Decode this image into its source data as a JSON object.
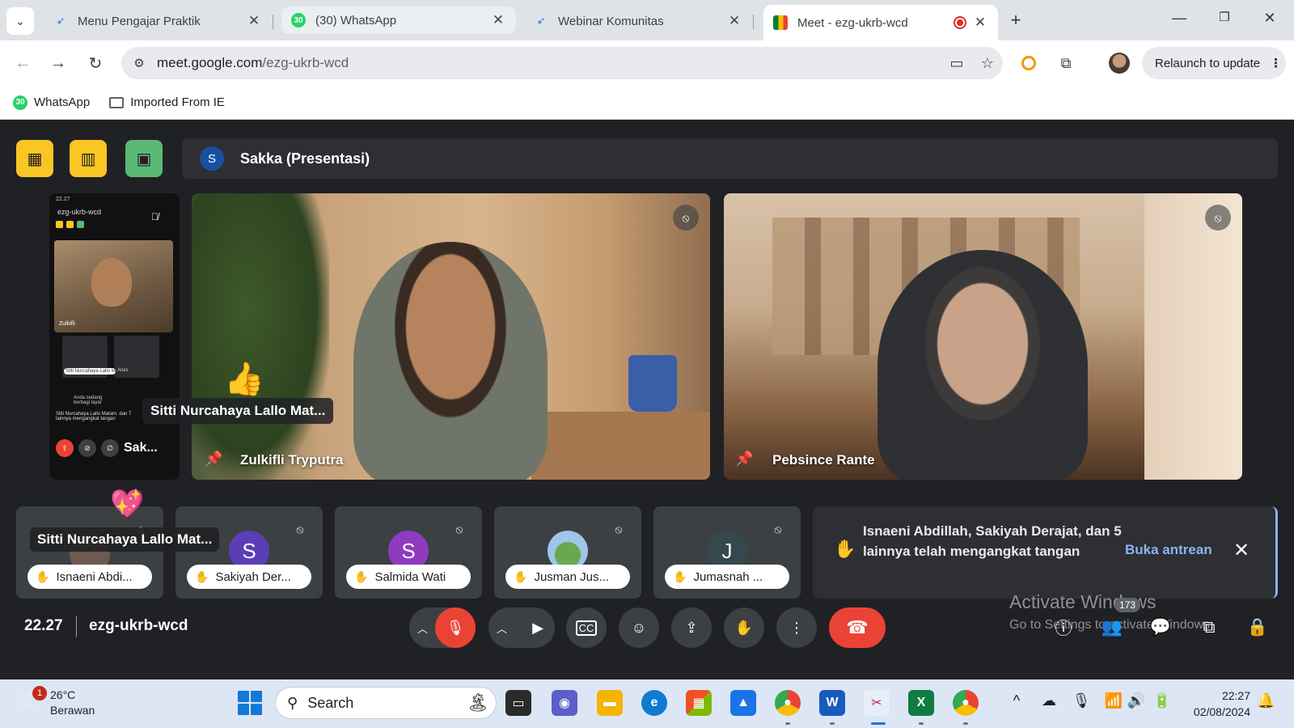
{
  "browser": {
    "tabs": [
      {
        "label": "Menu Pengajar Praktik",
        "icon": "bird-icon"
      },
      {
        "label": "(30) WhatsApp",
        "icon": "whatsapp-icon"
      },
      {
        "label": "Webinar Komunitas",
        "icon": "bird-icon"
      },
      {
        "label": "Meet - ezg-ukrb-wcd",
        "icon": "meet-icon",
        "active": true
      }
    ],
    "new_tab_glyph": "+",
    "url_domain": "meet.google.com",
    "url_path": "/ezg-ukrb-wcd",
    "relaunch_label": "Relaunch to update",
    "bookmarks": [
      {
        "label": "WhatsApp",
        "icon": "whatsapp-icon",
        "badge": "30"
      },
      {
        "label": "Imported From IE",
        "icon": "folder-icon"
      }
    ]
  },
  "meet": {
    "presenter_avatar": "S",
    "presenter_title": "Sakka (Presentasi)",
    "phone": {
      "status": "22.27",
      "code": "ezg-ukrb-wcd",
      "video_name": "Zulkifli",
      "cell_label_1": "Sitti Nurcahaya Lallo Mat...",
      "cell_label_2": "Aries",
      "note_1": "Anda sedang berbagi layar",
      "note_2": "Sitti Nurcahaya Lallo Matam. dan 7 lainnya mengangkat tangan",
      "bottom_label": "Sak..."
    },
    "tiles": [
      {
        "name": "Zulkifli Tryputra"
      },
      {
        "name": "Pebsince Rante"
      }
    ],
    "tooltip_top": "Sitti Nurcahaya Lallo Mat...",
    "tooltip_bottom": "Sitti Nurcahaya Lallo Mat...",
    "small_tiles": [
      {
        "avatar": "",
        "chip": "Isnaeni Abdi...",
        "color": "#3c4043"
      },
      {
        "avatar": "S",
        "chip": "Sakiyah Der...",
        "color": "#5b3eb5"
      },
      {
        "avatar": "S",
        "chip": "Salmida Wati",
        "color": "#8e3bc2"
      },
      {
        "avatar": "",
        "chip": "Jusman Jus...",
        "color": "#6aa84f"
      },
      {
        "avatar": "J",
        "chip": "Jumasnah ...",
        "color": "#37474f"
      }
    ],
    "notification": {
      "text": "Isnaeni Abdillah, Sakiyah Derajat, dan 5 lainnya telah mengangkat tangan",
      "action": "Buka antrean"
    },
    "time": "22.27",
    "code": "ezg-ukrb-wcd",
    "participants_count": "173",
    "activate_title": "Activate Windows",
    "activate_sub": "Go to Settings to activate Windows."
  },
  "taskbar": {
    "weather_temp": "26°C",
    "weather_desc": "Berawan",
    "weather_badge": "1",
    "search_placeholder": "Search",
    "time": "22:27",
    "date": "02/08/2024"
  },
  "colors": {
    "meet_bg": "#202124",
    "tool_yellow": "#f9c623",
    "tool_green": "#5bb974",
    "mic_red": "#ea4335",
    "link_blue": "#8ab4f8"
  }
}
